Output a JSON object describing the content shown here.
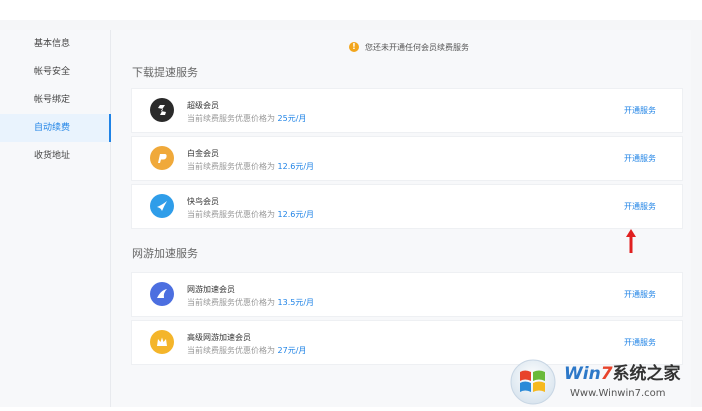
{
  "sidebar": {
    "items": [
      {
        "label": "基本信息",
        "active": false
      },
      {
        "label": "帐号安全",
        "active": false
      },
      {
        "label": "帐号绑定",
        "active": false
      },
      {
        "label": "自动续费",
        "active": true
      },
      {
        "label": "收货地址",
        "active": false
      }
    ]
  },
  "notice": {
    "icon": "warning-icon",
    "text": "您还未开通任何会员续费服务"
  },
  "download_section": {
    "title": "下载提速服务",
    "cards": [
      {
        "name": "超级会员",
        "desc": "当前续费服务优惠价格为",
        "price": "25元/月",
        "action": "开通服务",
        "icon": "super-member-icon",
        "color": "#2a2a2a"
      },
      {
        "name": "白金会员",
        "desc": "当前续费服务优惠价格为",
        "price": "12.6元/月",
        "action": "开通服务",
        "icon": "platinum-member-icon",
        "color": "#f0a93a"
      },
      {
        "name": "快鸟会员",
        "desc": "当前续费服务优惠价格为",
        "price": "12.6元/月",
        "action": "开通服务",
        "icon": "kuainiao-member-icon",
        "color": "#2f9de9"
      }
    ]
  },
  "game_section": {
    "title": "网游加速服务",
    "cards": [
      {
        "name": "网游加速会员",
        "desc": "当前续费服务优惠价格为",
        "price": "13.5元/月",
        "action": "开通服务",
        "icon": "game-accel-icon",
        "color": "#4c6fe0"
      },
      {
        "name": "高级网游加速会员",
        "desc": "当前续费服务优惠价格为",
        "price": "27元/月",
        "action": "开通服务",
        "icon": "premium-game-accel-icon",
        "color": "#f4b52a"
      }
    ]
  },
  "watermark": {
    "brand": "Win7系统之家",
    "url": "Www.Winwin7.com"
  }
}
